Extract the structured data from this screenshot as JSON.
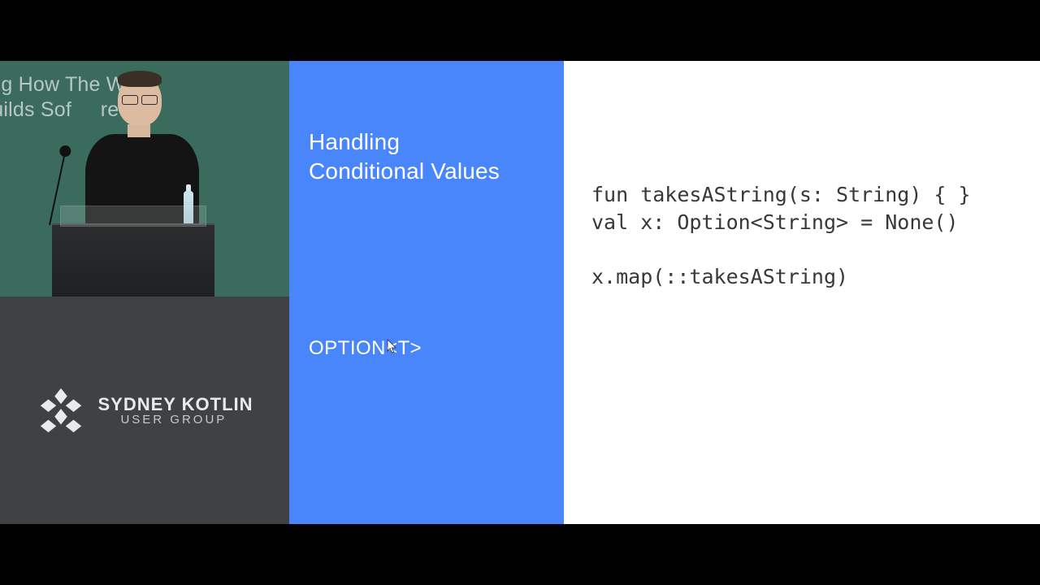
{
  "left": {
    "wall_line1": "rming How The World",
    "wall_line2": "Builds Sof     re",
    "logo": {
      "name_line1": "SYDNEY KOTLIN",
      "name_line2": "USER GROUP"
    }
  },
  "middle": {
    "title_line1": "Handling",
    "title_line2": "Conditional Values",
    "subheading": "OPTION<T>"
  },
  "code": {
    "line1": "fun takesAString(s: String) { }",
    "line2": "val x: Option<String> = None()",
    "blank": "",
    "line3": "x.map(::takesAString)"
  }
}
